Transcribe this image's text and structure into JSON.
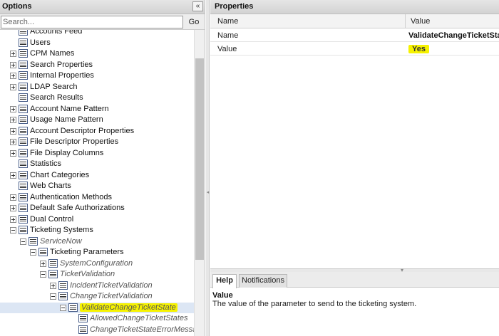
{
  "options_panel": {
    "title": "Options",
    "collapse_glyph": "«",
    "search": {
      "placeholder": "Search...",
      "value": "",
      "go_label": "Go"
    }
  },
  "tree": [
    {
      "label": "Accounts Feed",
      "toggle": "none",
      "italic": false,
      "highlight": false,
      "selected": false
    },
    {
      "label": "Users",
      "toggle": "none",
      "italic": false,
      "highlight": false,
      "selected": false
    },
    {
      "label": "CPM Names",
      "toggle": "plus",
      "italic": false,
      "highlight": false,
      "selected": false
    },
    {
      "label": "Search Properties",
      "toggle": "plus",
      "italic": false,
      "highlight": false,
      "selected": false
    },
    {
      "label": "Internal Properties",
      "toggle": "plus",
      "italic": false,
      "highlight": false,
      "selected": false
    },
    {
      "label": "LDAP Search",
      "toggle": "plus",
      "italic": false,
      "highlight": false,
      "selected": false
    },
    {
      "label": "Search Results",
      "toggle": "none",
      "italic": false,
      "highlight": false,
      "selected": false
    },
    {
      "label": "Account Name Pattern",
      "toggle": "plus",
      "italic": false,
      "highlight": false,
      "selected": false
    },
    {
      "label": "Usage Name Pattern",
      "toggle": "plus",
      "italic": false,
      "highlight": false,
      "selected": false
    },
    {
      "label": "Account Descriptor Properties",
      "toggle": "plus",
      "italic": false,
      "highlight": false,
      "selected": false
    },
    {
      "label": "File Descriptor Properties",
      "toggle": "plus",
      "italic": false,
      "highlight": false,
      "selected": false
    },
    {
      "label": "File Display Columns",
      "toggle": "plus",
      "italic": false,
      "highlight": false,
      "selected": false
    },
    {
      "label": "Statistics",
      "toggle": "none",
      "italic": false,
      "highlight": false,
      "selected": false
    },
    {
      "label": "Chart Categories",
      "toggle": "plus",
      "italic": false,
      "highlight": false,
      "selected": false
    },
    {
      "label": "Web Charts",
      "toggle": "none",
      "italic": false,
      "highlight": false,
      "selected": false
    },
    {
      "label": "Authentication Methods",
      "toggle": "plus",
      "italic": false,
      "highlight": false,
      "selected": false
    },
    {
      "label": "Default Safe Authorizations",
      "toggle": "plus",
      "italic": false,
      "highlight": false,
      "selected": false
    },
    {
      "label": "Dual Control",
      "toggle": "plus",
      "italic": false,
      "highlight": false,
      "selected": false
    },
    {
      "label": "Ticketing Systems",
      "toggle": "minus",
      "italic": false,
      "highlight": false,
      "selected": false
    },
    {
      "label": "ServiceNow",
      "toggle": "minus",
      "italic": true,
      "highlight": false,
      "selected": false
    },
    {
      "label": "Ticketing Parameters",
      "toggle": "minus",
      "italic": false,
      "highlight": false,
      "selected": false
    },
    {
      "label": "SystemConfiguration",
      "toggle": "plus",
      "italic": true,
      "highlight": false,
      "selected": false
    },
    {
      "label": "TicketValidation",
      "toggle": "minus",
      "italic": true,
      "highlight": false,
      "selected": false
    },
    {
      "label": "IncidentTicketValidation",
      "toggle": "plus",
      "italic": true,
      "highlight": false,
      "selected": false
    },
    {
      "label": "ChangeTicketValidation",
      "toggle": "minus",
      "italic": true,
      "highlight": false,
      "selected": false
    },
    {
      "label": "ValidateChangeTicketState",
      "toggle": "minus",
      "italic": true,
      "highlight": true,
      "selected": true
    },
    {
      "label": "AllowedChangeTicketStates",
      "toggle": "none",
      "italic": true,
      "highlight": false,
      "selected": false
    },
    {
      "label": "ChangeTicketStateErrorMessage",
      "toggle": "none",
      "italic": true,
      "highlight": false,
      "selected": false
    }
  ],
  "properties_panel": {
    "title": "Properties",
    "columns": {
      "name": "Name",
      "value": "Value"
    },
    "rows": [
      {
        "name": "Name",
        "value": "ValidateChangeTicketState",
        "highlight": false
      },
      {
        "name": "Value",
        "value": "Yes",
        "highlight": true
      }
    ]
  },
  "bottom_tabs": [
    {
      "label": "Help",
      "active": true
    },
    {
      "label": "Notifications",
      "active": false
    }
  ],
  "help": {
    "title": "Value",
    "text": "The value of the parameter to send to the ticketing system."
  },
  "colors": {
    "highlight": "#f6f200",
    "selection": "#dce6f4",
    "header_bg": "#d3d3d3",
    "icon_border": "#4a5f8a"
  },
  "icons": {
    "tree_node": "config-node-icon",
    "expand": "plus-toggle-icon",
    "collapse": "minus-toggle-icon",
    "collapse_panel": "double-chevron-left-icon"
  }
}
